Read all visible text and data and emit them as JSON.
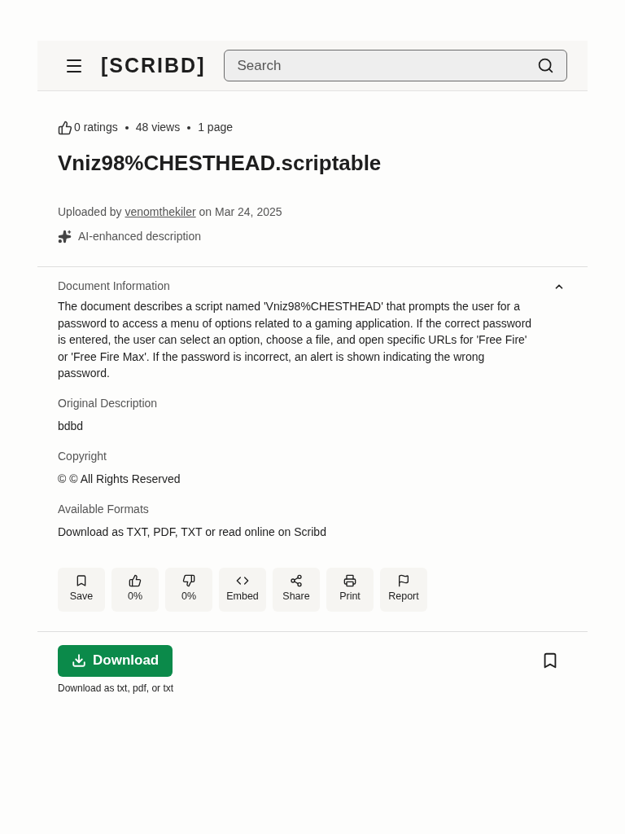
{
  "header": {
    "logo": "[SCRIBD]",
    "search": {
      "placeholder": "Search"
    }
  },
  "stats": [
    "0 ratings",
    "48 views",
    "1 page"
  ],
  "title": "Vniz98%CHESTHEAD.scriptable",
  "upload": {
    "prefix": "Uploaded by ",
    "user": "venomthekiler",
    "suffix": " on Mar 24, 2025"
  },
  "ai_note": "AI-enhanced description",
  "document_info": {
    "heading": "Document Information",
    "expanded": true,
    "text": "The document describes a script named 'Vniz98%CHESTHEAD' that prompts the user for a password to access a menu of options related to a gaming application. If the correct password is entered, the user can select an option, choose a file, and open specific URLs for 'Free Fire' or 'Free Fire Max'. If the password is incorrect, an alert is shown indicating the wrong password.",
    "sections": [
      {
        "heading": "Original Description",
        "text": "bdbd"
      },
      {
        "heading": "Copyright",
        "text": "© © All Rights Reserved"
      },
      {
        "heading": "Available Formats",
        "text": "Download as TXT, PDF, TXT or read online on Scribd"
      }
    ]
  },
  "actions": [
    {
      "kind": "save",
      "label": "Save"
    },
    {
      "kind": "like",
      "label": "0%"
    },
    {
      "kind": "dislike",
      "label": "0%"
    },
    {
      "kind": "embed",
      "label": "Embed"
    },
    {
      "kind": "share",
      "label": "Share"
    },
    {
      "kind": "print",
      "label": "Print"
    },
    {
      "kind": "report",
      "label": "Report"
    }
  ],
  "download": {
    "label": "Download",
    "note": "Download as txt, pdf, or txt"
  }
}
